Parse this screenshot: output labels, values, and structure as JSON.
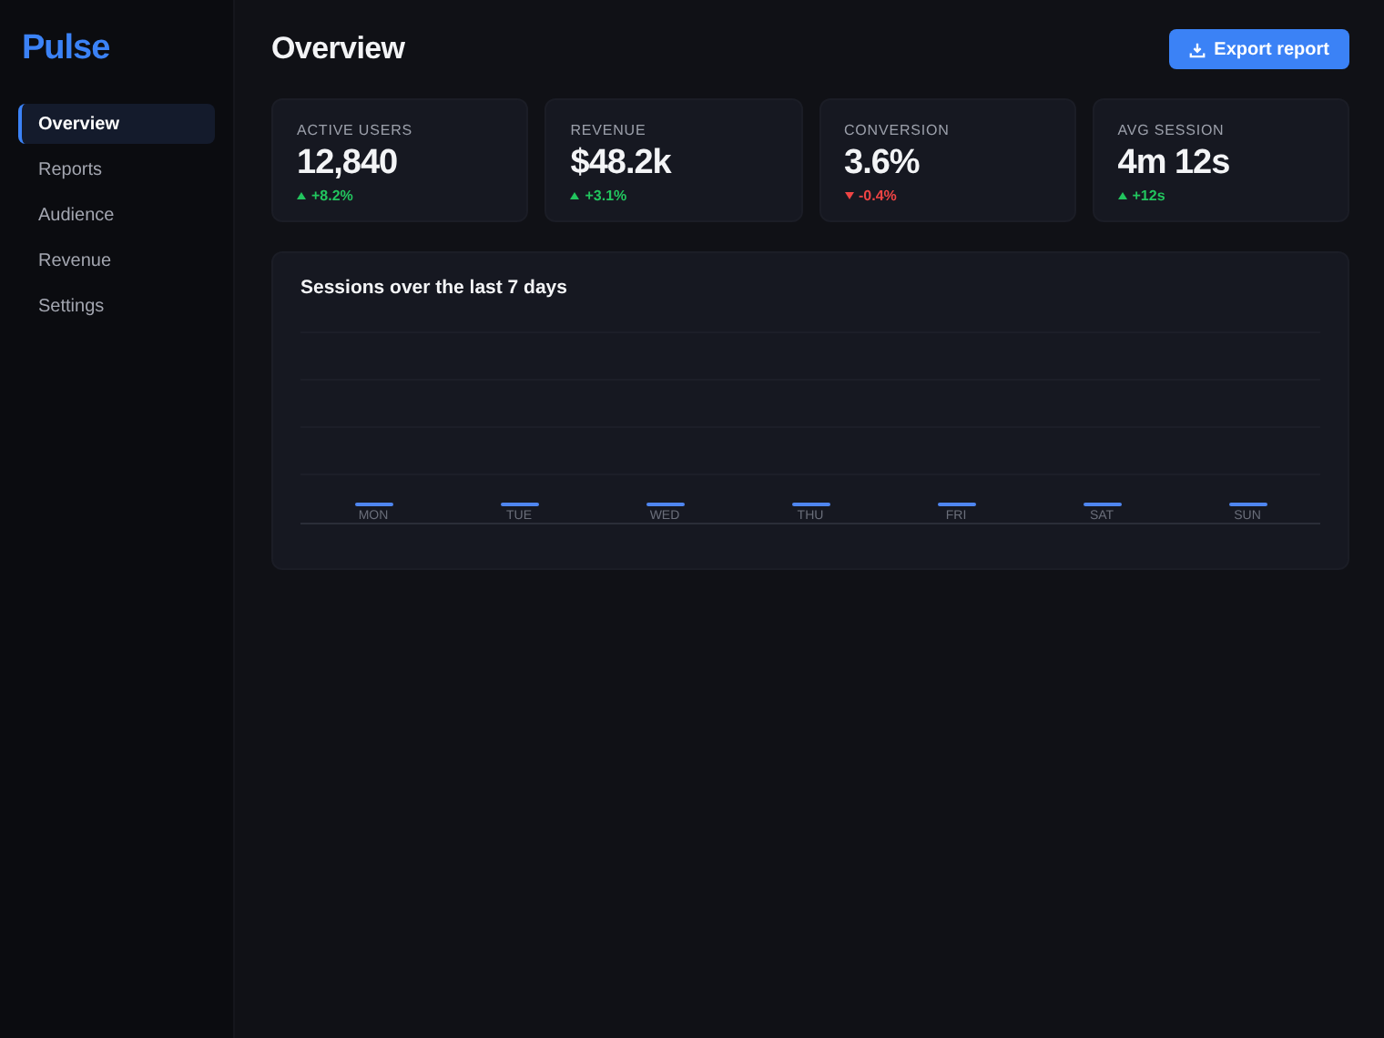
{
  "sidebar": {
    "logo": "Pulse",
    "items": [
      {
        "label": "Overview",
        "selected": true
      },
      {
        "label": "Reports",
        "selected": false
      },
      {
        "label": "Audience",
        "selected": false
      },
      {
        "label": "Revenue",
        "selected": false
      },
      {
        "label": "Settings",
        "selected": false
      }
    ]
  },
  "header": {
    "title": "Overview",
    "action": "Export report"
  },
  "stats": [
    {
      "label": "ACTIVE USERS",
      "value": "12,840",
      "delta": "+8.2%",
      "kind": "up"
    },
    {
      "label": "REVENUE",
      "value": "$48.2k",
      "delta": "+3.1%",
      "kind": "up"
    },
    {
      "label": "CONVERSION",
      "value": "3.6%",
      "delta": "-0.4%",
      "kind": "down"
    },
    {
      "label": "AVG SESSION",
      "value": "4m 12s",
      "delta": "+12s",
      "kind": "up"
    }
  ],
  "chart": {
    "title": "Sessions over the last 7 days",
    "days": [
      "MON",
      "TUE",
      "WED",
      "THU",
      "FRI",
      "SAT",
      "SUN"
    ]
  }
}
